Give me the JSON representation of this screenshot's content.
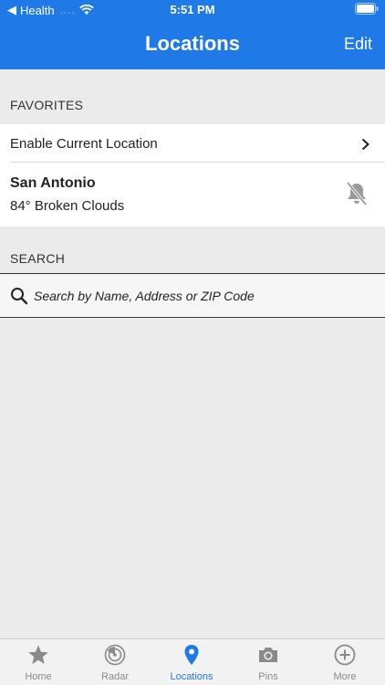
{
  "status_bar": {
    "carrier": "Health",
    "signal": "....",
    "time": "5:51 PM"
  },
  "nav": {
    "title": "Locations",
    "edit_label": "Edit"
  },
  "favorites": {
    "header": "FAVORITES",
    "enable_location_label": "Enable Current Location",
    "chevron": ">",
    "location": {
      "name": "San Antonio",
      "weather": "84° Broken Clouds"
    }
  },
  "search": {
    "header": "SEARCH",
    "placeholder": "Search by Name, Address or ZIP Code"
  },
  "tabs": [
    {
      "label": "Home",
      "icon": "star-icon",
      "active": false
    },
    {
      "label": "Radar",
      "icon": "radar-icon",
      "active": false
    },
    {
      "label": "Locations",
      "icon": "location-pin-icon",
      "active": true
    },
    {
      "label": "Pins",
      "icon": "camera-icon",
      "active": false
    },
    {
      "label": "More",
      "icon": "plus-circle-icon",
      "active": false
    }
  ],
  "colors": {
    "accent": "#1f7ae8",
    "background": "#ebebeb",
    "tab_inactive": "#8a8a8a"
  }
}
